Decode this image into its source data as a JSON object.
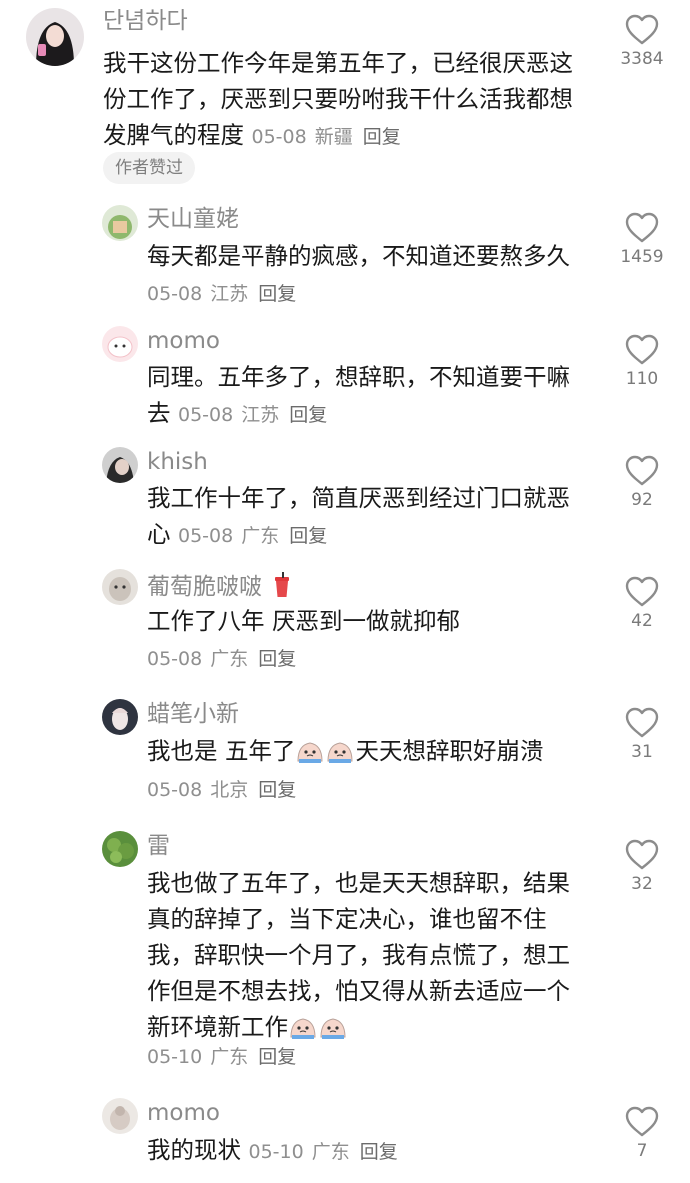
{
  "top_comment": {
    "username": "단념하다",
    "text": "我干这份工作今年是第五年了，已经很厌恶这份工作了，厌恶到只要吩咐我干什么活我都想发脾气的程度",
    "date": "05-08",
    "location": "新疆",
    "reply_label": "回复",
    "likes": "3384",
    "badge": "作者赞过"
  },
  "replies": [
    {
      "username": "天山童姥",
      "text": "每天都是平静的疯感，不知道还要熬多久",
      "date": "05-08",
      "location": "江苏",
      "reply_label": "回复",
      "likes": "1459"
    },
    {
      "username": "momo",
      "text": "同理。五年多了，想辞职，不知道要干嘛去",
      "date": "05-08",
      "location": "江苏",
      "reply_label": "回复",
      "likes": "110"
    },
    {
      "username": "khish",
      "text": "我工作十年了，简直厌恶到经过门口就恶心",
      "date": "05-08",
      "location": "广东",
      "reply_label": "回复",
      "likes": "92"
    },
    {
      "username": "葡萄脆啵啵",
      "text": "工作了八年 厌恶到一做就抑郁",
      "date": "05-08",
      "location": "广东",
      "reply_label": "回复",
      "likes": "42"
    },
    {
      "username": "蜡笔小新",
      "text_before": "我也是 五年了",
      "text_after": "天天想辞职好崩溃",
      "date": "05-08",
      "location": "北京",
      "reply_label": "回复",
      "likes": "31"
    },
    {
      "username": "雷",
      "text": "我也做了五年了，也是天天想辞职，结果真的辞掉了，当下定决心，谁也留不住我，辞职快一个月了，我有点慌了，想工作但是不想去找，怕又得从新去适应一个新环境新工作",
      "date": "05-10",
      "location": "广东",
      "reply_label": "回复",
      "likes": "32"
    },
    {
      "username": "momo",
      "text": "我的现状",
      "date": "05-10",
      "location": "广东",
      "reply_label": "回复",
      "likes": "7"
    }
  ],
  "icons": {
    "like": "heart-outline-icon",
    "emoji": "crying-bun-emoji",
    "cup": "drink-cup-emoji"
  }
}
